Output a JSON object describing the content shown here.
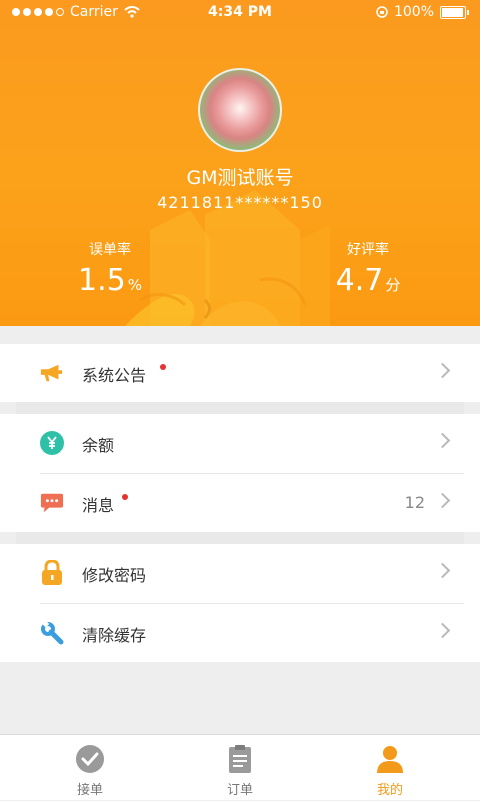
{
  "status_bar": {
    "carrier": "Carrier",
    "time": "4:34 PM",
    "battery": "100%"
  },
  "profile": {
    "name": "GM测试账号",
    "account": "4211811******150",
    "stats": [
      {
        "label": "误单率",
        "value": "1.5",
        "unit": "%"
      },
      {
        "label": "好评率",
        "value": "4.7",
        "unit": "分"
      }
    ]
  },
  "menu": {
    "announcement": {
      "label": "系统公告",
      "icon": "megaphone-icon"
    },
    "balance": {
      "label": "余额",
      "icon": "yen-icon"
    },
    "messages": {
      "label": "消息",
      "count": "12",
      "icon": "chat-icon"
    },
    "change_password": {
      "label": "修改密码",
      "icon": "lock-icon"
    },
    "clear_cache": {
      "label": "清除缓存",
      "icon": "wrench-icon"
    }
  },
  "tabs": [
    {
      "label": "接单",
      "icon": "check-circle-icon",
      "active": false
    },
    {
      "label": "订单",
      "icon": "clipboard-icon",
      "active": false
    },
    {
      "label": "我的",
      "icon": "person-icon",
      "active": true
    }
  ],
  "colors": {
    "accent": "#f39a1a",
    "header": "#fb9a1f",
    "badge": "#e6322f"
  }
}
